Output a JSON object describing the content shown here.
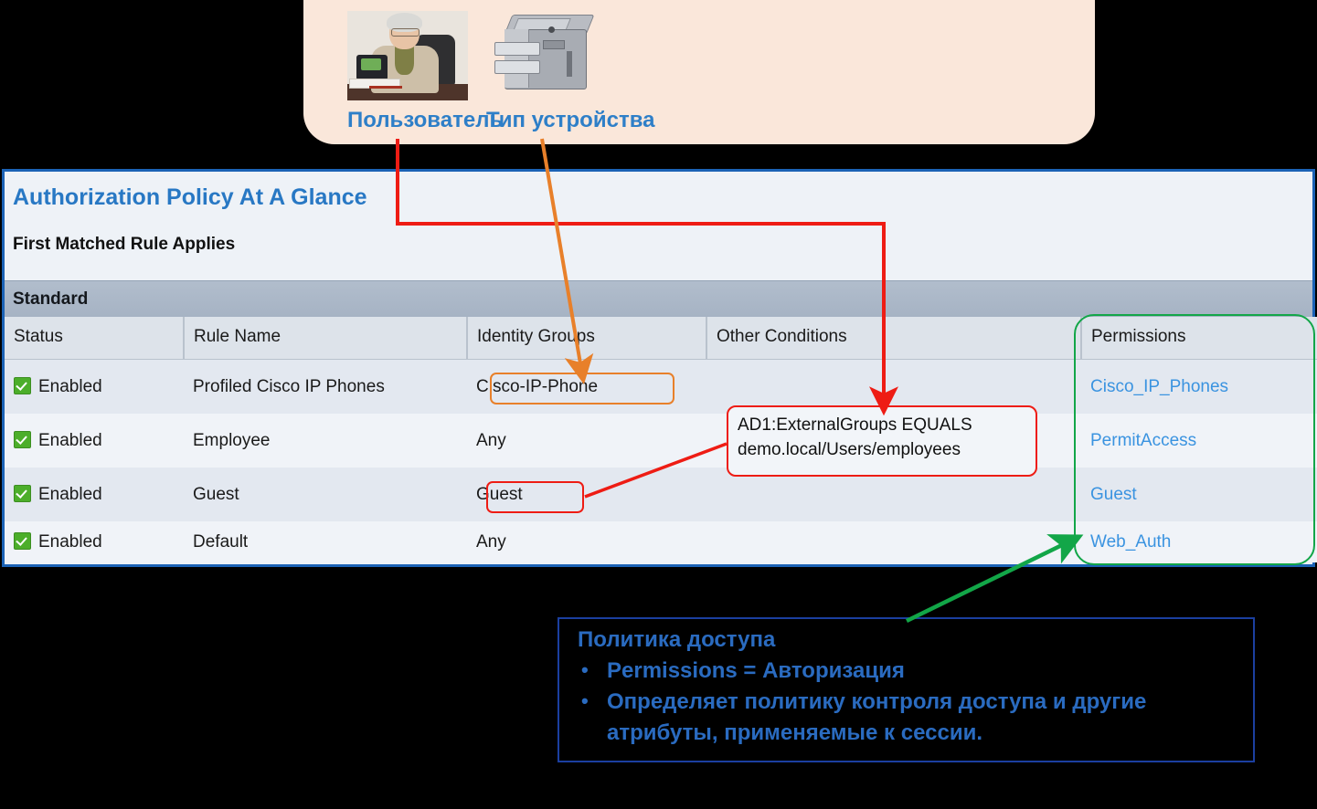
{
  "top_callout": {
    "user_label": "Пользователь",
    "device_label": "Тип устройства",
    "person_icon": "person-at-desk-icon",
    "printer_icon": "printer-icon",
    "bg_color": "#fae7da",
    "label_color": "#2e7fc8"
  },
  "panel": {
    "title": "Authorization Policy At A Glance",
    "subtitle": "First Matched Rule Applies",
    "section_label": "Standard",
    "border_color": "#1b62b5",
    "title_color": "#2878c4"
  },
  "table": {
    "columns": [
      "Status",
      "Rule Name",
      "Identity Groups",
      "Other Conditions",
      "Permissions"
    ],
    "rows": [
      {
        "status": "Enabled",
        "rule_name": "Profiled Cisco IP Phones",
        "identity_groups": "Cisco-IP-Phone",
        "other_conditions": "",
        "permissions": "Cisco_IP_Phones"
      },
      {
        "status": "Enabled",
        "rule_name": "Employee",
        "identity_groups": "Any",
        "other_conditions": "",
        "permissions": "PermitAccess"
      },
      {
        "status": "Enabled",
        "rule_name": "Guest",
        "identity_groups": "Guest",
        "other_conditions": "",
        "permissions": "Guest"
      },
      {
        "status": "Enabled",
        "rule_name": "Default",
        "identity_groups": "Any",
        "other_conditions": "",
        "permissions": "Web_Auth"
      }
    ],
    "link_color": "#3a93e0"
  },
  "annotations": {
    "ad1_callout_line1": "AD1:ExternalGroups EQUALS",
    "ad1_callout_line2": "demo.local/Users/employees",
    "highlight_cisco_phone_color": "#e8802a",
    "highlight_guest_color": "#ee1c14",
    "highlight_permissions_color": "#12a648"
  },
  "bottom_box": {
    "title": "Политика доступа",
    "bullets": [
      "Permissions = Авторизация",
      "Определяет политику контроля доступа и другие атрибуты, применяемые к сессии."
    ],
    "border_color": "#1b3fa0",
    "text_color": "#2a6bc0"
  }
}
